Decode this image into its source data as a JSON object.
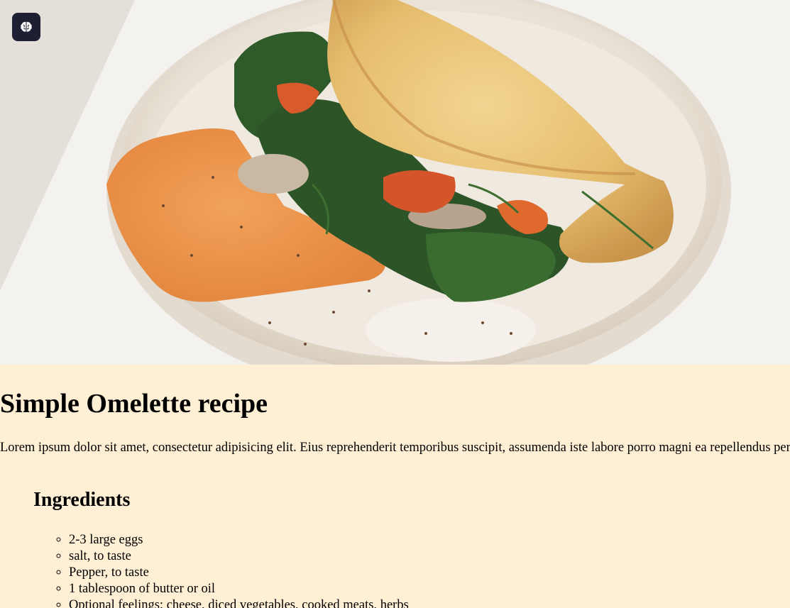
{
  "hero": {
    "image_alt": "Folded crepe omelette with spinach, mushrooms, dill and orange spread on a white plate",
    "brain_icon": "brain-icon"
  },
  "colors": {
    "page_background": "#ffefd5",
    "button_background": "#1f1f33"
  },
  "recipe": {
    "title": "Simple Omelette recipe",
    "intro": "Lorem ipsum dolor sit amet, consectetur adipisicing elit. Eius reprehenderit temporibus suscipit, assumenda iste labore porro magni ea repellendus perferendis.",
    "ingredients_heading": "Ingredients",
    "ingredients": [
      "2-3 large eggs",
      "salt, to taste",
      "Pepper, to taste",
      "1 tablespoon of butter or oil",
      "Optional feelings: cheese, diced vegetables, cooked meats, herbs"
    ]
  }
}
